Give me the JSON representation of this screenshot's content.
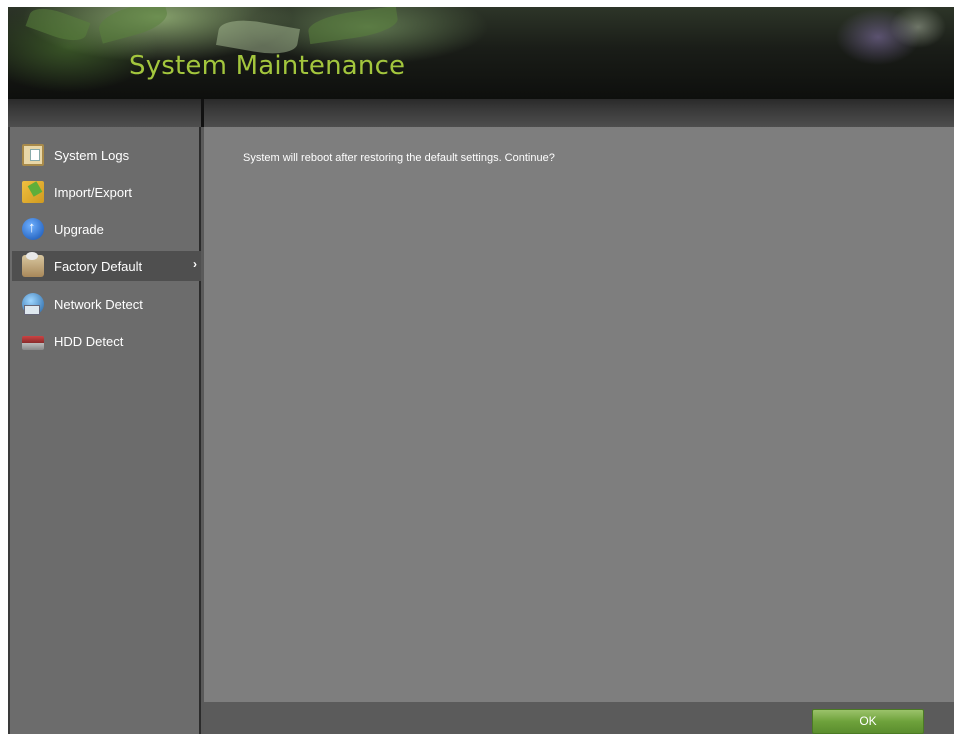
{
  "header": {
    "title": "System Maintenance"
  },
  "sidebar": {
    "items": [
      {
        "label": "System Logs",
        "icon": "system-logs-icon",
        "active": false
      },
      {
        "label": "Import/Export",
        "icon": "import-export-icon",
        "active": false
      },
      {
        "label": "Upgrade",
        "icon": "upgrade-icon",
        "active": false
      },
      {
        "label": "Factory Default",
        "icon": "factory-default-icon",
        "active": true,
        "chevron": "›"
      },
      {
        "label": "Network Detect",
        "icon": "network-detect-icon",
        "active": false
      },
      {
        "label": "HDD Detect",
        "icon": "hdd-detect-icon",
        "active": false
      }
    ]
  },
  "main": {
    "message": "System will reboot after restoring the default settings. Continue?"
  },
  "footer": {
    "ok_label": "OK"
  },
  "colors": {
    "title": "#a3c63d",
    "content_bg": "#7e7e7e",
    "sidebar_bg": "#6c6c6c",
    "active_item_bg": "#4f4f4f",
    "ok_button": "#6ea23b"
  }
}
